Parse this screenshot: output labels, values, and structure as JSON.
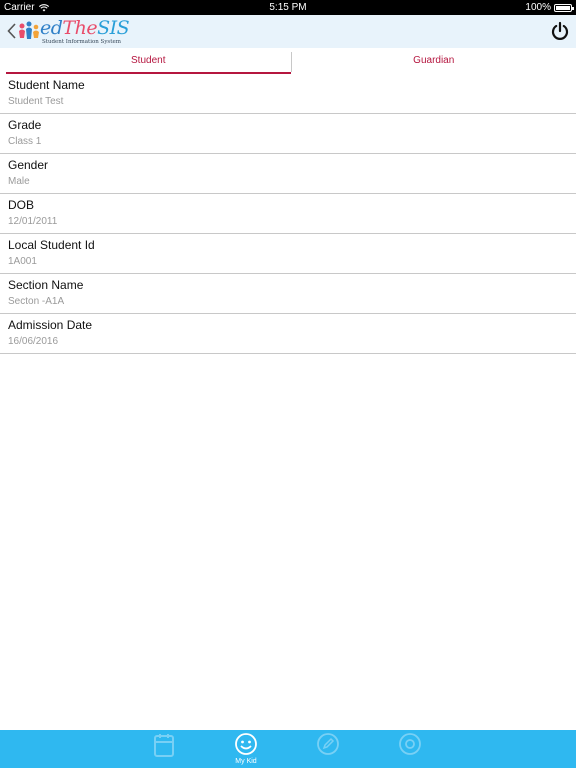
{
  "status_bar": {
    "carrier": "Carrier",
    "time": "5:15 PM",
    "battery": "100%"
  },
  "header": {
    "logo_brand_ed": "ed",
    "logo_brand_the": "The",
    "logo_brand_sis": "SIS",
    "logo_subtitle": "Student Information System"
  },
  "tabs": [
    {
      "label": "Student",
      "active": true
    },
    {
      "label": "Guardian",
      "active": false
    }
  ],
  "fields": [
    {
      "label": "Student Name",
      "value": "Student Test"
    },
    {
      "label": "Grade",
      "value": "Class 1"
    },
    {
      "label": "Gender",
      "value": "Male"
    },
    {
      "label": "DOB",
      "value": "12/01/2011"
    },
    {
      "label": "Local Student Id",
      "value": "1A001"
    },
    {
      "label": "Section Name",
      "value": "Secton -A1A"
    },
    {
      "label": "Admission Date",
      "value": "16/06/2016"
    }
  ],
  "tab_bar": {
    "items": [
      {
        "icon": "calendar-icon",
        "label": ""
      },
      {
        "icon": "smiley-icon",
        "label": "My Kid"
      },
      {
        "icon": "edit-icon",
        "label": ""
      },
      {
        "icon": "settings-icon",
        "label": ""
      }
    ],
    "color": "#2fb8f0"
  },
  "colors": {
    "accent": "#b5163f",
    "header_bg": "#e8f3fb"
  }
}
